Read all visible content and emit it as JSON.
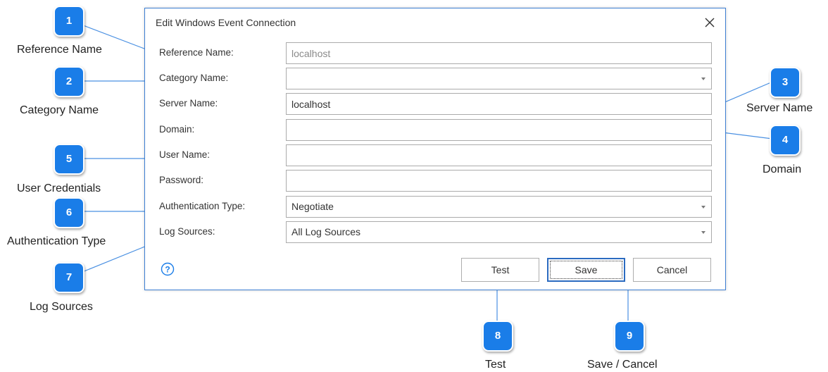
{
  "dialog": {
    "title": "Edit Windows Event Connection",
    "fields": {
      "reference_name": {
        "label": "Reference Name:",
        "value": "localhost"
      },
      "category_name": {
        "label": "Category Name:",
        "value": ""
      },
      "server_name": {
        "label": "Server Name:",
        "value": "localhost"
      },
      "domain": {
        "label": "Domain:",
        "value": ""
      },
      "user_name": {
        "label": "User Name:",
        "value": ""
      },
      "password": {
        "label": "Password:",
        "value": ""
      },
      "authentication_type": {
        "label": "Authentication Type:",
        "value": "Negotiate"
      },
      "log_sources": {
        "label": "Log Sources:",
        "value": "All Log Sources"
      }
    },
    "buttons": {
      "test": "Test",
      "save": "Save",
      "cancel": "Cancel"
    }
  },
  "callouts": [
    {
      "number": "1",
      "label": "Reference Name"
    },
    {
      "number": "2",
      "label": "Category Name"
    },
    {
      "number": "3",
      "label": "Server Name"
    },
    {
      "number": "4",
      "label": "Domain"
    },
    {
      "number": "5",
      "label": "User Credentials"
    },
    {
      "number": "6",
      "label": "Authentication Type"
    },
    {
      "number": "7",
      "label": "Log Sources"
    },
    {
      "number": "8",
      "label": "Test"
    },
    {
      "number": "9",
      "label": "Save / Cancel"
    }
  ],
  "colors": {
    "badge": "#1a7de8",
    "accent_border": "#3d7fd3",
    "leader_line": "#4a90e2"
  }
}
